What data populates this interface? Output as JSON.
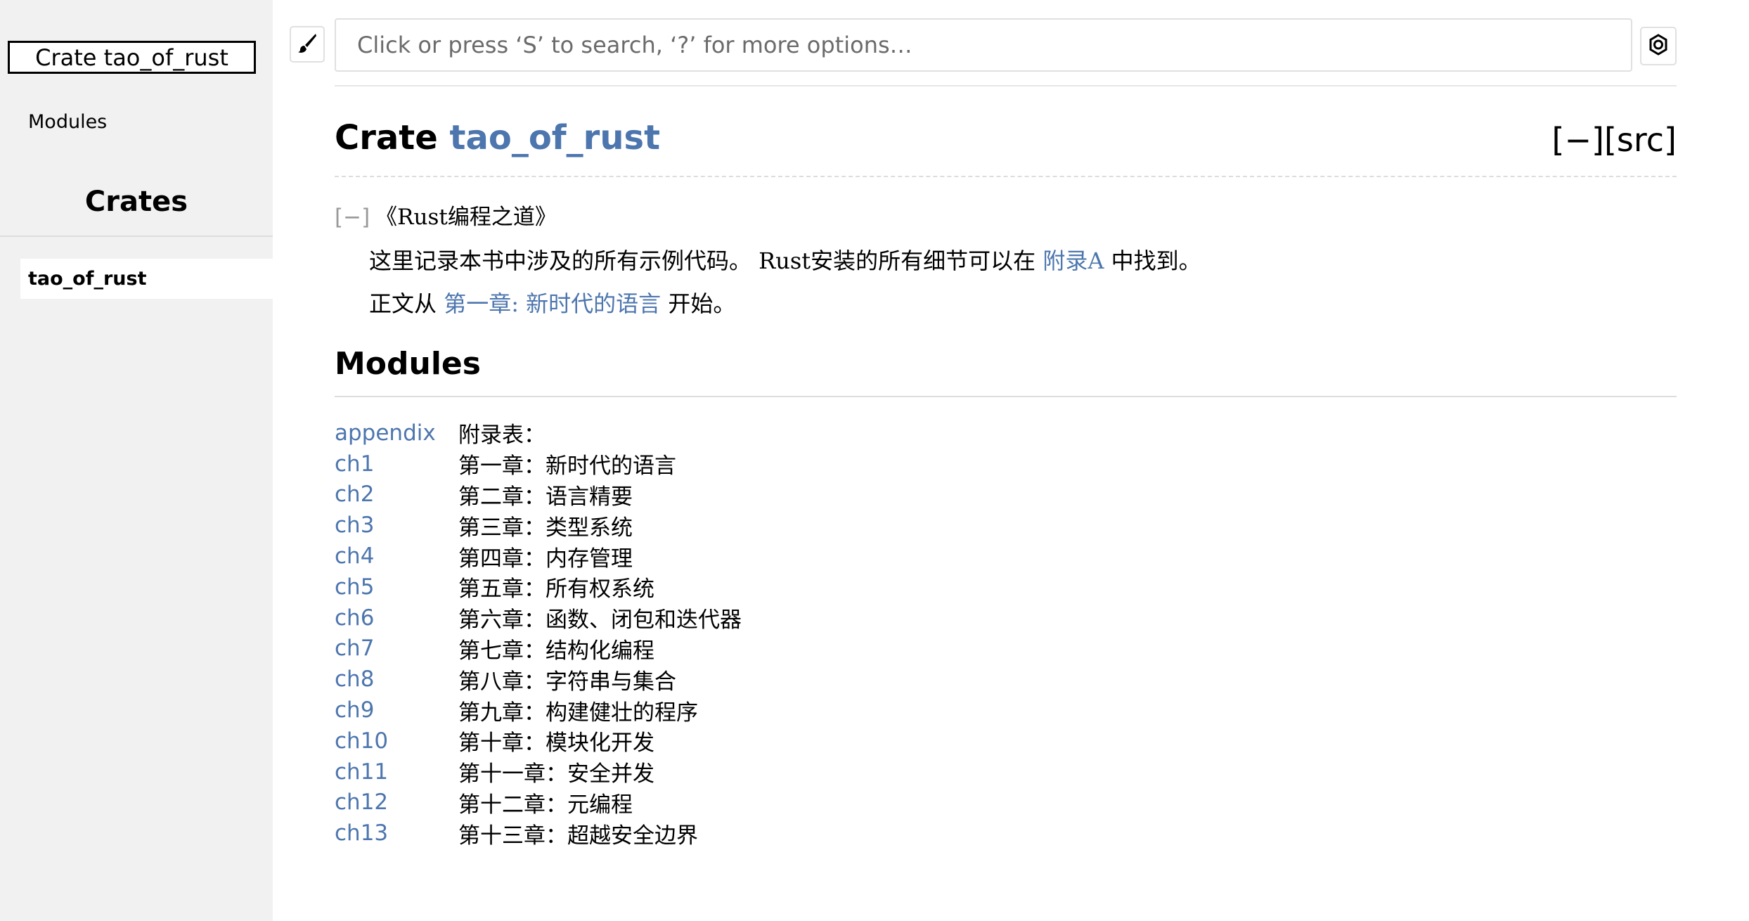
{
  "sidebar": {
    "crate_box_label": "Crate tao_of_rust",
    "modules_link": "Modules",
    "crates_heading": "Crates",
    "crate_items": [
      "tao_of_rust"
    ]
  },
  "search": {
    "placeholder": "Click or press ‘S’ to search, ‘?’ for more options…",
    "theme_icon": "paintbrush-icon",
    "settings_icon": "gear-icon"
  },
  "main": {
    "title_prefix": "Crate ",
    "crate_name": "tao_of_rust",
    "collapse_label": "[−]",
    "src_label": "[src]",
    "doc_toggle": "[−]",
    "doc_title": "《Rust编程之道》",
    "para1_text": "这里记录本书中涉及的所有示例代码。 Rust安装的所有细节可以在 ",
    "para1_link": "附录A",
    "para1_suffix": " 中找到。",
    "para2_prefix": "正文从 ",
    "para2_link": "第一章: 新时代的语言",
    "para2_suffix": " 开始。",
    "modules_heading": "Modules"
  },
  "modules": [
    {
      "name": "appendix",
      "desc": "附录表："
    },
    {
      "name": "ch1",
      "desc": "第一章：新时代的语言"
    },
    {
      "name": "ch2",
      "desc": "第二章：语言精要"
    },
    {
      "name": "ch3",
      "desc": "第三章：类型系统"
    },
    {
      "name": "ch4",
      "desc": "第四章：内存管理"
    },
    {
      "name": "ch5",
      "desc": "第五章：所有权系统"
    },
    {
      "name": "ch6",
      "desc": "第六章：函数、闭包和迭代器"
    },
    {
      "name": "ch7",
      "desc": "第七章：结构化编程"
    },
    {
      "name": "ch8",
      "desc": "第八章：字符串与集合"
    },
    {
      "name": "ch9",
      "desc": "第九章：构建健壮的程序"
    },
    {
      "name": "ch10",
      "desc": "第十章：模块化开发"
    },
    {
      "name": "ch11",
      "desc": "第十一章：安全并发"
    },
    {
      "name": "ch12",
      "desc": "第十二章：元编程"
    },
    {
      "name": "ch13",
      "desc": "第十三章：超越安全边界"
    }
  ],
  "colors": {
    "link": "#4d76ae",
    "sidebar_bg": "#f1f1f1",
    "divider": "#dddddd"
  }
}
